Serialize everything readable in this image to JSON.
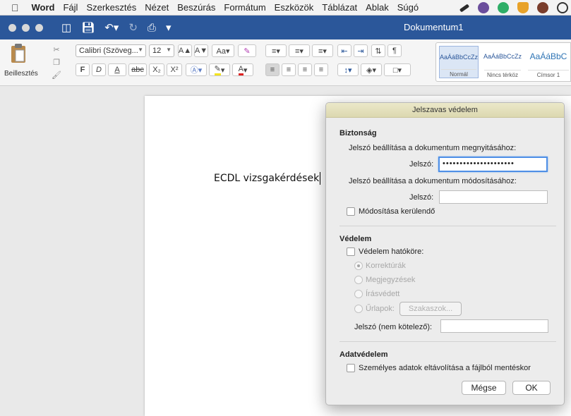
{
  "menubar": {
    "app": "Word",
    "items": [
      "Fájl",
      "Szerkesztés",
      "Nézet",
      "Beszúrás",
      "Formátum",
      "Eszközök",
      "Táblázat",
      "Ablak",
      "Súgó"
    ]
  },
  "titlebar": {
    "title": "Dokumentum1"
  },
  "ribbon": {
    "paste_label": "Beillesztés",
    "font_name": "Calibri (Szöveg...",
    "font_size": "12",
    "bold": "F",
    "italic": "D",
    "underline": "A",
    "strikethrough": "abc",
    "subscript": "X₂",
    "superscript": "X²",
    "styles": [
      {
        "sample": "AaÁáBbCcZz",
        "name": "Normál"
      },
      {
        "sample": "AaÁáBbCcZz",
        "name": "Nincs térköz"
      },
      {
        "sample": "AaÁáBbC",
        "name": "Címsor 1"
      }
    ]
  },
  "document": {
    "text": "ECDL vizsgakérdések"
  },
  "dialog": {
    "title": "Jelszavas védelem",
    "security": {
      "heading": "Biztonság",
      "open_label": "Jelszó beállítása a dokumentum megnyitásához:",
      "password_label": "Jelszó:",
      "open_password": "•••••••••••••••••••••",
      "modify_label": "Jelszó beállítása a dokumentum módosításához:",
      "modify_password_label": "Jelszó:",
      "modify_password": "",
      "avoid_modify_label": "Módosítása kerülendő"
    },
    "protection": {
      "heading": "Védelem",
      "scope_label": "Védelem hatóköre:",
      "options": [
        "Korrektúrák",
        "Megjegyzések",
        "Írásvédett",
        "Űrlapok:"
      ],
      "sections_button": "Szakaszok...",
      "optional_password_label": "Jelszó (nem kötelező):",
      "optional_password": ""
    },
    "privacy": {
      "heading": "Adatvédelem",
      "remove_personal_label": "Személyes adatok eltávolítása a fájlból mentéskor"
    },
    "buttons": {
      "cancel": "Mégse",
      "ok": "OK"
    }
  }
}
